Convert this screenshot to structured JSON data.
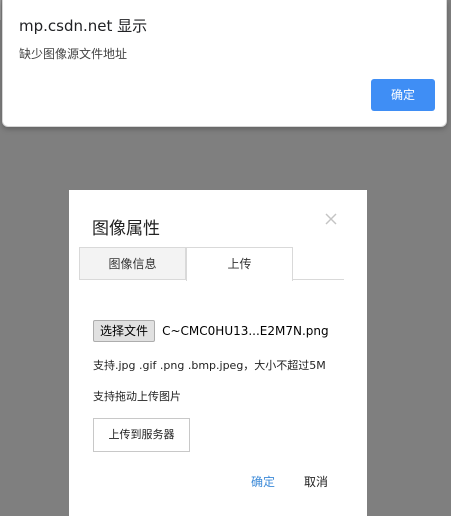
{
  "alert": {
    "title": "mp.csdn.net 显示",
    "message": "缺少图像源文件地址",
    "ok_label": "确定",
    "ok_color": "#3f8ef5"
  },
  "dialog": {
    "title": "图像属性",
    "close_icon": "close-icon",
    "tabs": [
      {
        "label": "图像信息",
        "active": false
      },
      {
        "label": "上传",
        "active": true
      }
    ],
    "file_button_label": "选择文件",
    "file_name": "C~CMC0HU13...E2M7N.png",
    "hint_formats": "支持.jpg .gif .png .bmp.jpeg，大小不超过5M",
    "hint_drag": "支持拖动上传图片",
    "upload_button_label": "上传到服务器",
    "ok_label": "确定",
    "cancel_label": "取消",
    "ok_color": "#3c8ad8"
  }
}
